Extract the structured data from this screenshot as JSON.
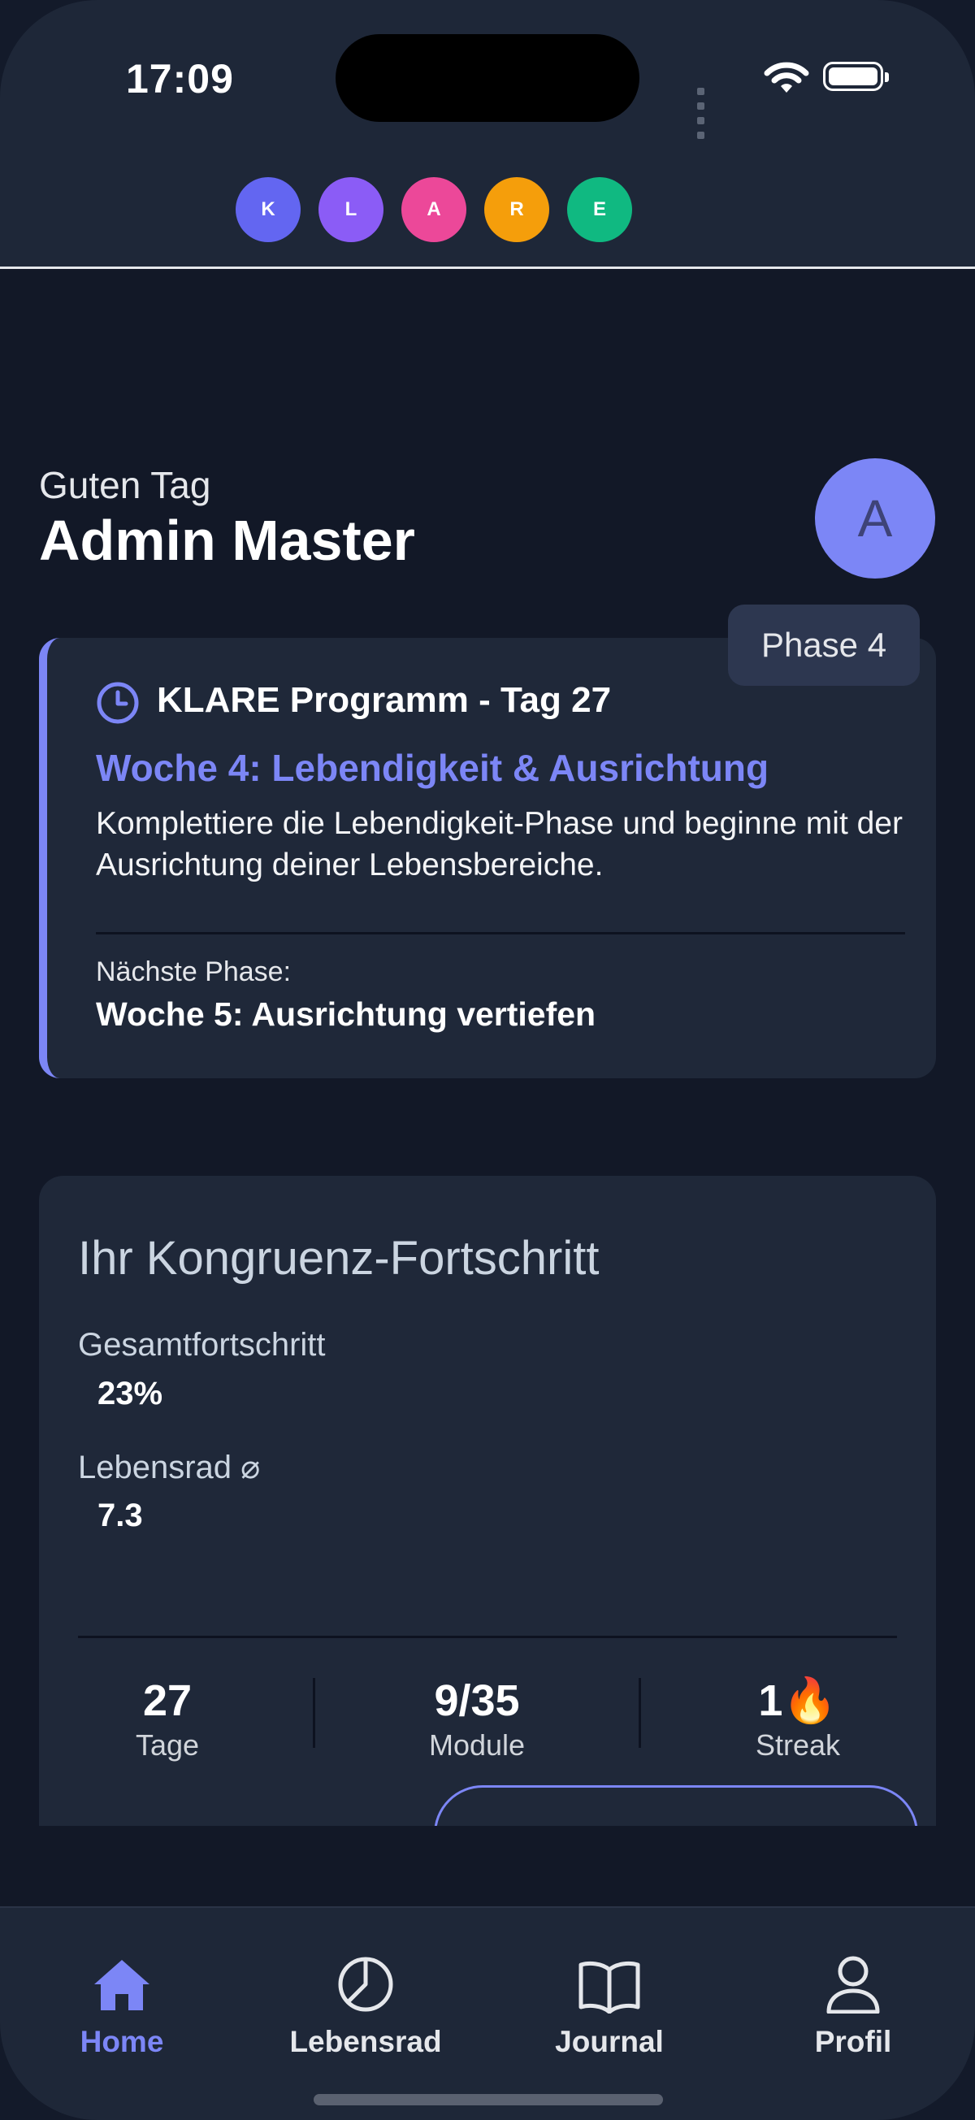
{
  "status_bar": {
    "time": "17:09"
  },
  "header": {
    "logo_letters": [
      {
        "letter": "K",
        "color": "#6366f1"
      },
      {
        "letter": "L",
        "color": "#8b5cf6"
      },
      {
        "letter": "A",
        "color": "#ec4899"
      },
      {
        "letter": "R",
        "color": "#f59e0b"
      },
      {
        "letter": "E",
        "color": "#10b981"
      }
    ]
  },
  "greeting": {
    "salutation": "Guten Tag",
    "user_name": "Admin Master",
    "avatar_initial": "A"
  },
  "program_card": {
    "phase_badge": "Phase 4",
    "title": "KLARE Programm - Tag 27",
    "week_title": "Woche 4: Lebendigkeit & Ausrichtung",
    "week_description": "Komplettiere die Lebendigkeit-Phase und beginne mit der Ausrichtung deiner Lebensbereiche.",
    "next_phase_label": "Nächste Phase:",
    "next_phase_value": "Woche 5: Ausrichtung vertiefen",
    "accent_color": "#7c86f6"
  },
  "progress_card": {
    "title": "Ihr Kongruenz-Fortschritt",
    "overall_label": "Gesamtfortschritt",
    "overall_value": "23%",
    "lebensrad_label": "Lebensrad ⌀",
    "lebensrad_value": "7.3",
    "stats": [
      {
        "value": "27",
        "label": "Tage"
      },
      {
        "value": "9/35",
        "label": "Module"
      },
      {
        "value": "1🔥",
        "label": "Streak"
      }
    ]
  },
  "tab_bar": {
    "active_color": "#7c86f6",
    "tabs": [
      {
        "label": "Home",
        "icon": "home-icon",
        "active": true
      },
      {
        "label": "Lebensrad",
        "icon": "pie-chart-icon",
        "active": false
      },
      {
        "label": "Journal",
        "icon": "book-icon",
        "active": false
      },
      {
        "label": "Profil",
        "icon": "user-icon",
        "active": false
      }
    ]
  }
}
